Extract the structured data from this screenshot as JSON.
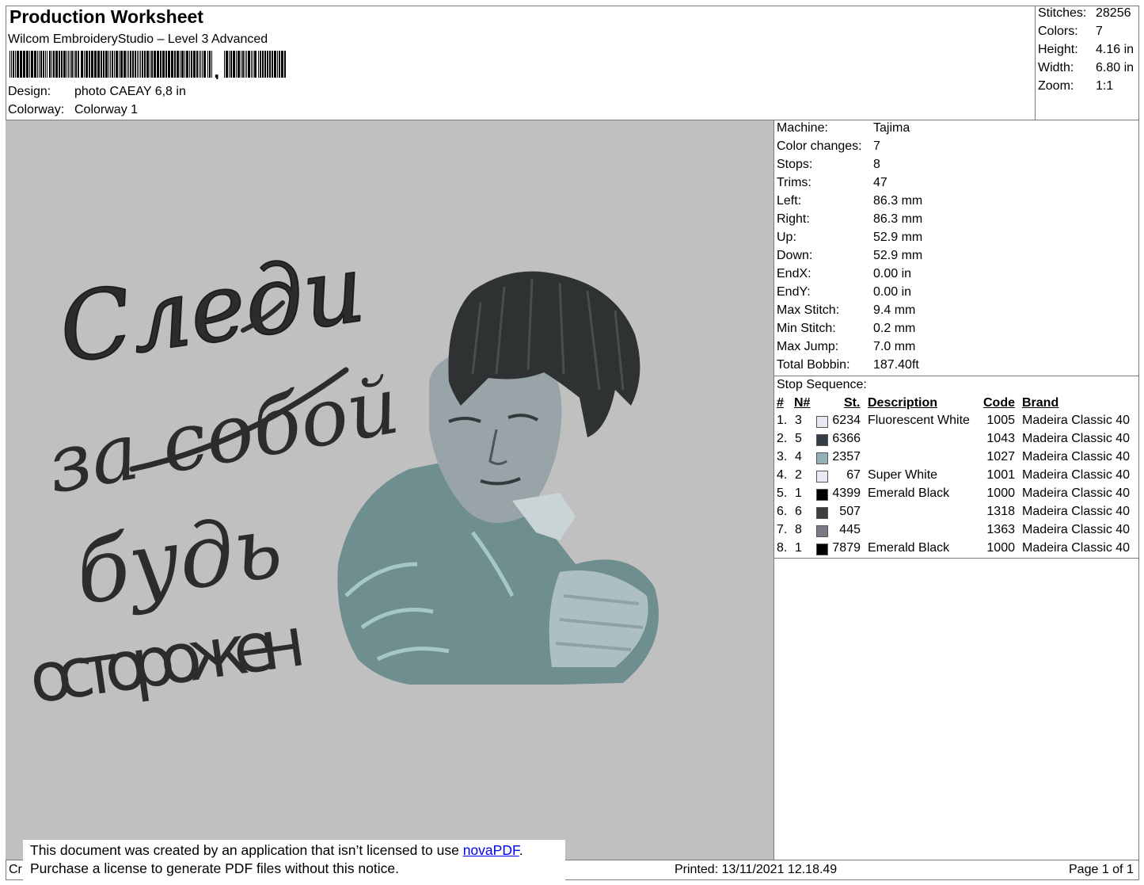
{
  "header": {
    "title": "Production Worksheet",
    "subtitle": "Wilcom EmbroideryStudio – Level 3 Advanced",
    "design_label": "Design:",
    "design_value": "photo CAEAY 6,8 in",
    "colorway_label": "Colorway:",
    "colorway_value": "Colorway 1"
  },
  "stats": [
    {
      "label": "Stitches:",
      "value": "28256"
    },
    {
      "label": "Colors:",
      "value": "7"
    },
    {
      "label": "Height:",
      "value": "4.16 in"
    },
    {
      "label": "Width:",
      "value": "6.80 in"
    },
    {
      "label": "Zoom:",
      "value": "1:1"
    }
  ],
  "properties": [
    {
      "label": "Machine:",
      "value": "Tajima"
    },
    {
      "label": "Color changes:",
      "value": "7"
    },
    {
      "label": "Stops:",
      "value": "8"
    },
    {
      "label": "Trims:",
      "value": "47"
    },
    {
      "label": "Left:",
      "value": "86.3 mm"
    },
    {
      "label": "Right:",
      "value": "86.3 mm"
    },
    {
      "label": "Up:",
      "value": "52.9 mm"
    },
    {
      "label": "Down:",
      "value": "52.9 mm"
    },
    {
      "label": "EndX:",
      "value": "0.00 in"
    },
    {
      "label": "EndY:",
      "value": "0.00 in"
    },
    {
      "label": "Max Stitch:",
      "value": "9.4 mm"
    },
    {
      "label": "Min Stitch:",
      "value": "0.2 mm"
    },
    {
      "label": "Max Jump:",
      "value": "7.0 mm"
    },
    {
      "label": "Total Bobbin:",
      "value": "187.40ft"
    }
  ],
  "stop_sequence": {
    "title": "Stop Sequence:",
    "headers": {
      "num": "#",
      "n": "N#",
      "st": "St.",
      "description": "Description",
      "code": "Code",
      "brand": "Brand"
    },
    "rows": [
      {
        "num": "1.",
        "n": "3",
        "color": "#e6e8f4",
        "st": "6234",
        "description": "Fluorescent White",
        "code": "1005",
        "brand": "Madeira Classic 40"
      },
      {
        "num": "2.",
        "n": "5",
        "color": "#343c48",
        "st": "6366",
        "description": "",
        "code": "1043",
        "brand": "Madeira Classic 40"
      },
      {
        "num": "3.",
        "n": "4",
        "color": "#93b1b6",
        "st": "2357",
        "description": "",
        "code": "1027",
        "brand": "Madeira Classic 40"
      },
      {
        "num": "4.",
        "n": "2",
        "color": "#e8eaf4",
        "st": "67",
        "description": "Super White",
        "code": "1001",
        "brand": "Madeira Classic 40"
      },
      {
        "num": "5.",
        "n": "1",
        "color": "#000000",
        "st": "4399",
        "description": "Emerald Black",
        "code": "1000",
        "brand": "Madeira Classic 40"
      },
      {
        "num": "6.",
        "n": "6",
        "color": "#3e3e42",
        "st": "507",
        "description": "",
        "code": "1318",
        "brand": "Madeira Classic 40"
      },
      {
        "num": "7.",
        "n": "8",
        "color": "#7a7a84",
        "st": "445",
        "description": "",
        "code": "1363",
        "brand": "Madeira Classic 40"
      },
      {
        "num": "8.",
        "n": "1",
        "color": "#000000",
        "st": "7879",
        "description": "Emerald Black",
        "code": "1000",
        "brand": "Madeira Classic 40"
      }
    ]
  },
  "artwork": {
    "lines": [
      "Следи",
      "за собой",
      "будь",
      "осторожен"
    ]
  },
  "notice": {
    "line1_prefix": "This document was created by an application that isn’t licensed to use ",
    "link": "novaPDF",
    "line1_suffix": ".",
    "line2": "Purchase a license to generate PDF files without this notice."
  },
  "footer": {
    "left": "Cr",
    "printed": "Printed: 13/11/2021 12.18.49",
    "page": "Page 1 of 1"
  }
}
